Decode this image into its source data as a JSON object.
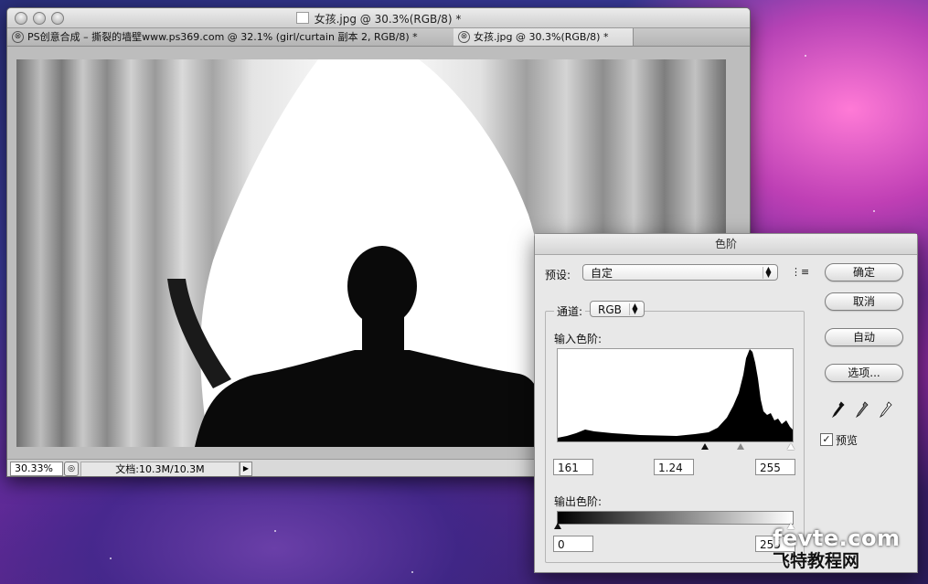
{
  "document_window": {
    "title": "女孩.jpg @ 30.3%(RGB/8) *",
    "tabs": [
      {
        "label": "PS创意合成 – 撕裂的墙壁www.ps369.com @ 32.1% (girl/curtain 副本 2, RGB/8) *",
        "close": "⊗"
      },
      {
        "label": "女孩.jpg @ 30.3%(RGB/8) *",
        "close": "⊗"
      }
    ],
    "status": {
      "zoom": "30.33%",
      "doc_info": "文档:10.3M/10.3M",
      "arrow": "▶"
    }
  },
  "levels_dialog": {
    "title": "色阶",
    "preset_label": "预设:",
    "preset_value": "自定",
    "channel_label": "通道:",
    "channel_value": "RGB",
    "input_levels_label": "输入色阶:",
    "input_values": {
      "black": "161",
      "gamma": "1.24",
      "white": "255"
    },
    "output_levels_label": "输出色阶:",
    "output_values": {
      "black": "0",
      "white": "255"
    },
    "buttons": {
      "ok": "确定",
      "cancel": "取消",
      "auto": "自动",
      "options": "选项..."
    },
    "preview_label": "预览",
    "preview_checked": true,
    "eyedroppers": [
      "black-eyedropper-icon",
      "gray-eyedropper-icon",
      "white-eyedropper-icon"
    ]
  },
  "watermark": {
    "line1": "fevte.com",
    "line2": "飞特教程网"
  }
}
